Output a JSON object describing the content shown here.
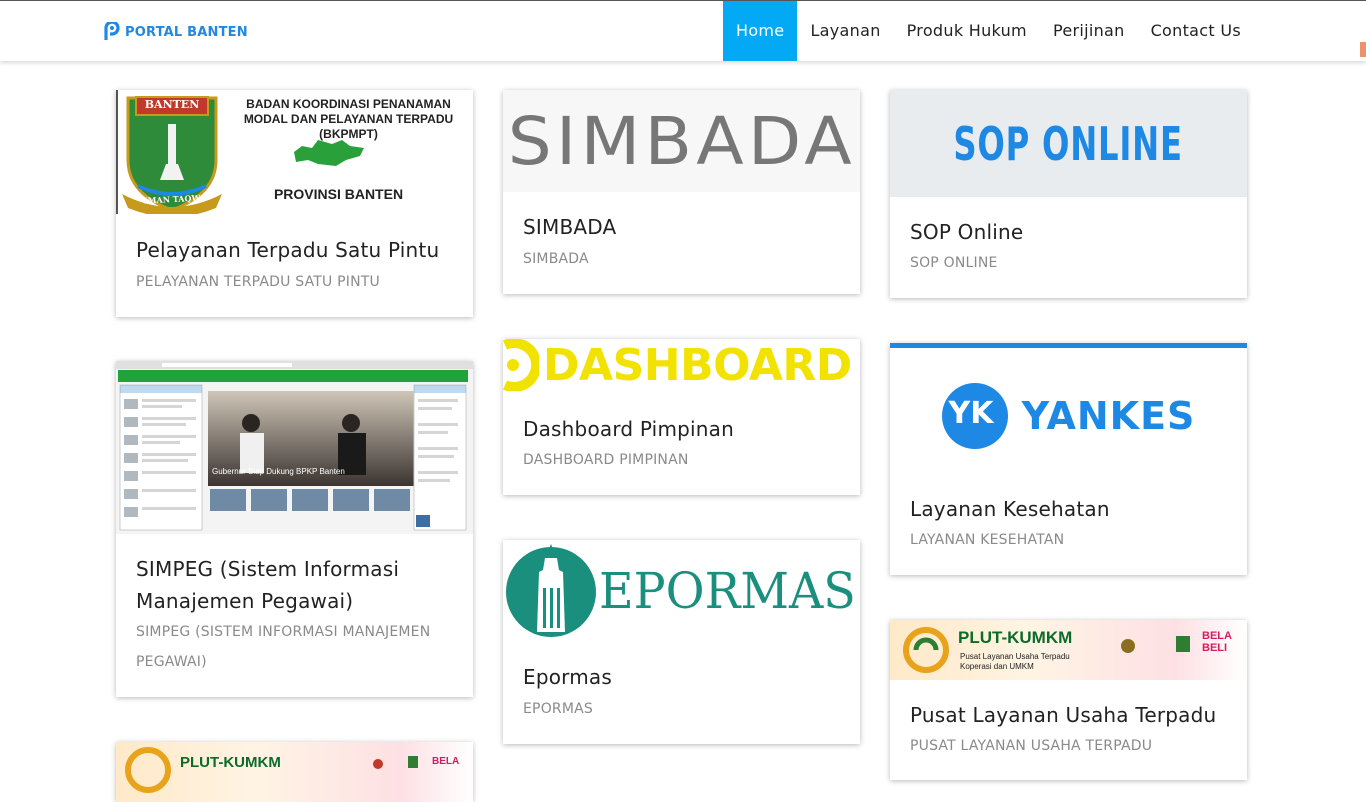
{
  "header": {
    "brand": "PORTAL BANTEN",
    "nav": [
      "Home",
      "Layanan",
      "Produk Hukum",
      "Perijinan",
      "Contact Us"
    ],
    "active_nav": "Home"
  },
  "colors": {
    "accent": "#03a9f4",
    "brand_blue": "#1e88e5",
    "title_text": "#222222",
    "subtitle_text": "#8a8a8a"
  },
  "cards": {
    "ptsp": {
      "image_title": "BADAN KOORDINASI PENANAMAN MODAL DAN PELAYANAN TERPADU (BKPMPT)",
      "image_label": "PROVINSI BANTEN",
      "seal_top": "BANTEN",
      "seal_bottom": "IMAN TAQWA",
      "title": "Pelayanan Terpadu Satu Pintu",
      "subtitle": "PELAYANAN TERPADU SATU PINTU"
    },
    "simbada": {
      "image_text": "SIMBADA",
      "title": "SIMBADA",
      "subtitle": "SIMBADA"
    },
    "sop": {
      "image_text": "SOP ONLINE",
      "title": "SOP Online",
      "subtitle": "SOP ONLINE"
    },
    "simpeg": {
      "image_caption": "Gubernur Siap Dukung BPKP Banten",
      "title": "SIMPEG (Sistem Informasi Manajemen Pegawai)",
      "subtitle": "SIMPEG (SISTEM INFORMASI MANAJEMEN PEGAWAI)"
    },
    "dashboard": {
      "image_text": "DASHBOARD",
      "title": "Dashboard Pimpinan",
      "subtitle": "DASHBOARD PIMPINAN"
    },
    "yankes": {
      "image_badge": "YK",
      "image_text": "YANKES",
      "title": "Layanan Kesehatan",
      "subtitle": "LAYANAN KESEHATAN"
    },
    "epormas": {
      "image_text": "EPORMAS",
      "title": "Epormas",
      "subtitle": "EPORMAS"
    },
    "plut": {
      "image_text": "PLUT-KUMKM",
      "image_sub": "Pusat Layanan Usaha Terpadu Koperasi dan UMKM",
      "image_side": "BELA BELI",
      "title": "Pusat Layanan Usaha Terpadu",
      "subtitle": "PUSAT LAYANAN USAHA TERPADU"
    },
    "plut2": {
      "image_text": "PLUT-KUMKM",
      "image_side": "BELA"
    }
  }
}
